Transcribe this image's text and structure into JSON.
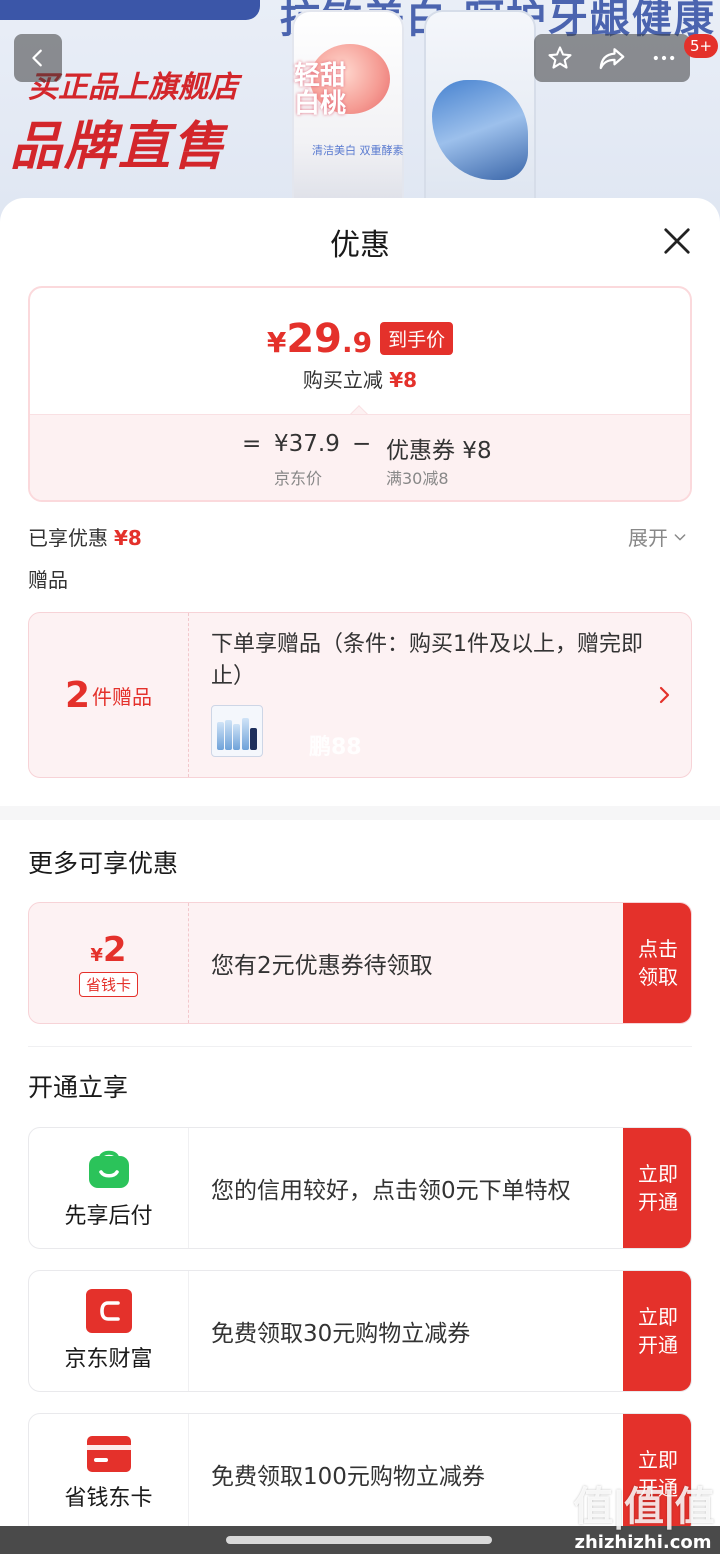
{
  "banner": {
    "headline": "抗敏美白 呵护牙龈健康",
    "slogan_line1": "买正品上旗舰店",
    "slogan_line2": "品牌直售",
    "bottle_label": "轻甜\n白桃",
    "bottle_sub": "清洁美白 双重酵素",
    "cart_badge": "5+"
  },
  "sheet": {
    "title": "优惠"
  },
  "price_card": {
    "currency": "¥",
    "final_int": "29",
    "final_dec": ".9",
    "final_tag": "到手价",
    "sub_label": "购买立减",
    "sub_amount": "¥8",
    "equals": "=",
    "jd_price": "¥37.9",
    "jd_price_label": "京东价",
    "minus": "−",
    "coupon": "优惠券 ¥8",
    "coupon_rule": "满30减8"
  },
  "summary": {
    "enjoyed_label": "已享优惠",
    "enjoyed_amount": "¥8",
    "expand_label": "展开",
    "gift_section": "赠品"
  },
  "gift": {
    "count": "2",
    "unit": "件赠品",
    "description": "下单享赠品（条件：购买1件及以上，赠完即止）",
    "watermark": "鹏88"
  },
  "more_offers": {
    "title": "更多可享优惠",
    "coupon_currency": "¥",
    "coupon_value": "2",
    "coupon_tag": "省钱卡",
    "coupon_text": "您有2元优惠券待领取",
    "coupon_btn": "点击\n领取"
  },
  "open_section": {
    "title": "开通立享",
    "items": [
      {
        "name": "先享后付",
        "icon": "shopping-bag-icon",
        "color": "#2bc35a",
        "text": "您的信用较好，点击领0元下单特权",
        "button": "立即\n开通"
      },
      {
        "name": "京东财富",
        "icon": "jd-finance-icon",
        "color": "#e4312b",
        "text": "免费领取30元购物立减券",
        "button": "立即\n开通"
      },
      {
        "name": "省钱东卡",
        "icon": "card-icon",
        "color": "#e4312b",
        "text": "免费领取100元购物立减券",
        "button": "立即\n开通"
      }
    ]
  },
  "site": {
    "logo": "值|值|值",
    "url": "zhizhizhi.com"
  },
  "colors": {
    "accent": "#e4312b",
    "pink_bg": "#fdf2f3",
    "green": "#2bc35a"
  }
}
